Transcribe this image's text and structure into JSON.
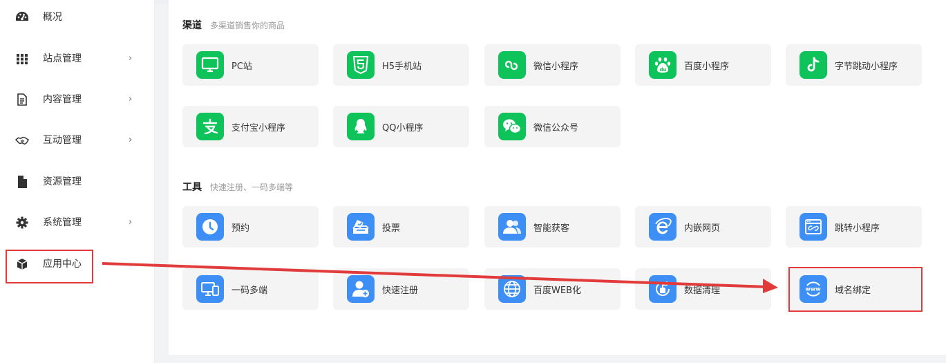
{
  "colors": {
    "green": "#0ec45a",
    "blue": "#3d8ff6",
    "highlight": "#e23b3b"
  },
  "sidebar": {
    "items": [
      {
        "label": "概况",
        "icon": "dashboard-icon",
        "arrow": ""
      },
      {
        "label": "站点管理",
        "icon": "grid-icon",
        "arrow": "›"
      },
      {
        "label": "内容管理",
        "icon": "document-icon",
        "arrow": "›"
      },
      {
        "label": "互动管理",
        "icon": "handshake-icon",
        "arrow": "›"
      },
      {
        "label": "资源管理",
        "icon": "file-icon",
        "arrow": ""
      },
      {
        "label": "系统管理",
        "icon": "gear-icon",
        "arrow": "›"
      },
      {
        "label": "应用中心",
        "icon": "box-icon",
        "arrow": ""
      }
    ]
  },
  "channels": {
    "title": "渠道",
    "subtitle": "多渠道销售你的商品",
    "items": [
      {
        "label": "PC站",
        "icon": "monitor-icon"
      },
      {
        "label": "H5手机站",
        "icon": "html5-icon"
      },
      {
        "label": "微信小程序",
        "icon": "wechat-miniprogram-icon"
      },
      {
        "label": "百度小程序",
        "icon": "baidu-paw-icon"
      },
      {
        "label": "字节跳动小程序",
        "icon": "tiktok-icon"
      },
      {
        "label": "支付宝小程序",
        "icon": "alipay-icon"
      },
      {
        "label": "QQ小程序",
        "icon": "qq-penguin-icon"
      },
      {
        "label": "微信公众号",
        "icon": "wechat-icon"
      }
    ]
  },
  "tools": {
    "title": "工具",
    "subtitle": "快速注册、一码多端等",
    "items": [
      {
        "label": "预约",
        "icon": "clock-icon"
      },
      {
        "label": "投票",
        "icon": "ballot-box-icon"
      },
      {
        "label": "智能获客",
        "icon": "users-icon"
      },
      {
        "label": "内嵌网页",
        "icon": "ie-browser-icon"
      },
      {
        "label": "跳转小程序",
        "icon": "browser-link-icon"
      },
      {
        "label": "一码多端",
        "icon": "devices-icon"
      },
      {
        "label": "快速注册",
        "icon": "add-user-icon"
      },
      {
        "label": "百度WEB化",
        "icon": "globe-icon"
      },
      {
        "label": "数据清理",
        "icon": "data-clean-icon"
      },
      {
        "label": "域名绑定",
        "icon": "www-domain-icon"
      }
    ]
  }
}
